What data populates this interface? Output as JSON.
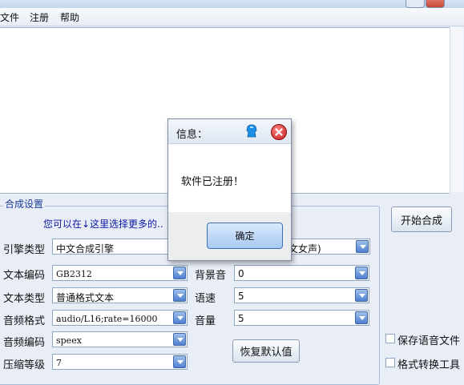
{
  "menu": {
    "file": "文件",
    "register": "注册",
    "help": "帮助"
  },
  "settings": {
    "group_title": "合成设置",
    "hint": "您可以在↓这里选择更多的..",
    "engine_type": {
      "label": "引擎类型",
      "value": "中文合成引擎"
    },
    "voice": {
      "value": "文女声)"
    },
    "text_encoding": {
      "label": "文本编码",
      "value": "GB2312"
    },
    "background_sound": {
      "label": "背景音",
      "value": "0"
    },
    "text_type": {
      "label": "文本类型",
      "value": "普通格式文本"
    },
    "speed": {
      "label": "语速",
      "value": "5"
    },
    "audio_format": {
      "label": "音频格式",
      "value": "audio/L16;rate=16000"
    },
    "volume": {
      "label": "音量",
      "value": "5"
    },
    "audio_encoding": {
      "label": "音频编码",
      "value": "speex"
    },
    "compression_level": {
      "label": "压缩等级",
      "value": "7"
    },
    "restore_defaults": "恢复默认值"
  },
  "right_panel": {
    "start_synthesis": "开始合成",
    "save_audio": "保存语音文件",
    "format_tool": "格式转换工具"
  },
  "dialog": {
    "title": "信息：",
    "message": "软件已注册！",
    "ok": "确定"
  },
  "colors": {
    "accent": "#1a3a99",
    "hint": "#0d17a8",
    "close": "#c01515"
  }
}
